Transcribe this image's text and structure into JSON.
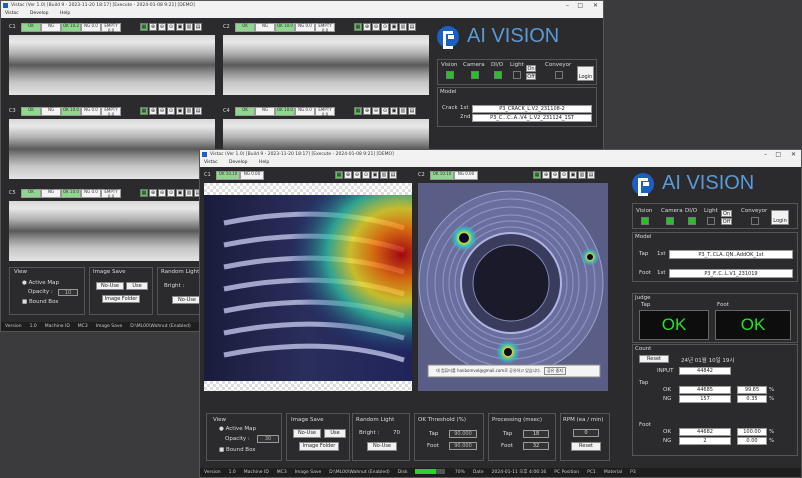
{
  "back": {
    "title": "Vistac (Ver 1.0) [Build 9 - 2023-11-20 18:17] [Execute - 2024-01-08 9:21] [DEMO]",
    "menu": [
      "Vistac",
      "Develop",
      "Help"
    ],
    "cameras": [
      {
        "label": "C1",
        "stats": [
          "OK",
          "NG",
          "OK 10.2",
          "NG 0.0",
          "EMPTY 0.0"
        ]
      },
      {
        "label": "C2",
        "stats": [
          "OK",
          "NG",
          "OK 10.0",
          "NG 0.0",
          "EMPTY 0.0"
        ]
      },
      {
        "label": "C3",
        "stats": [
          "OK",
          "NG",
          "OK 10.0",
          "NG 0.0",
          "EMPTY 0.0"
        ]
      },
      {
        "label": "C4",
        "stats": [
          "OK",
          "NG",
          "OK 10.0",
          "NG 0.0",
          "EMPTY 0.0"
        ]
      },
      {
        "label": "C5",
        "stats": [
          "OK",
          "NG",
          "OK 10.0",
          "NG 0.0",
          "EMPTY 0.0"
        ]
      }
    ],
    "brand": "AI VISION",
    "status_labels": [
      "Vision",
      "Camera",
      "DI/O",
      "Light",
      "Conveyor"
    ],
    "light_on": "On",
    "light_off": "Off",
    "login": "Login",
    "model_title": "Model",
    "crack": "Crack",
    "first": "1st",
    "second": "2nd",
    "model1": "P3_CRACK_L.V2_231108-2",
    "model2": "P3_C...C..A..V4_L.V2_231124_1ST",
    "view": "View",
    "active_map": "Active Map",
    "opacity": "Opacity :",
    "opacity_val": "10",
    "bound_box": "Bound Box",
    "image_save": "Image Save",
    "no_use": "No-Use",
    "use": "Use",
    "image_folder": "Image Folder",
    "random_light": "Random Light",
    "bright": "Bright :",
    "statusbar": [
      "Version",
      "1.0",
      "Machine ID",
      "MC3",
      "Image Save",
      "D:\\ML00\\Wahnut (Enabled)"
    ]
  },
  "front": {
    "title": "Vistac (Ver 1.0) [Build 9 - 2023-11-20 18:17] [Execute - 2024-01-08 9:21] [DEMO]",
    "menu": [
      "Vistac",
      "Develop",
      "Help"
    ],
    "cameras": [
      {
        "label": "C1",
        "stats": [
          "OK 10.10",
          "NG 0.00"
        ]
      },
      {
        "label": "C2",
        "stats": [
          "OK 10.10",
          "NG 0.00"
        ]
      }
    ],
    "brand": "AI VISION",
    "status_labels": [
      "Vision",
      "Camera",
      "DI/O",
      "Light",
      "Conveyor"
    ],
    "light_on": "On",
    "light_off": "Off",
    "login": "Login",
    "model_title": "Model",
    "tap": "Tap",
    "foot": "Foot",
    "first": "1st",
    "model_tap": "P3_T..CLA..QN..AddOK_1st",
    "model_foot": "P3_F..C..L.V1_231019",
    "judge_title": "Judge",
    "judge_tap": "OK",
    "judge_foot": "OK",
    "count_title": "Count",
    "reset": "Reset",
    "count_date": "24년 01월 10일 19시",
    "input_label": "INPUT",
    "input_val": "44842",
    "tap_ok": "44685",
    "tap_ok_pct": "99.65",
    "tap_ng": "157",
    "tap_ng_pct": "0.35",
    "foot_ok": "44682",
    "foot_ok_pct": "100.00",
    "foot_ng": "2",
    "foot_ng_pct": "0.00",
    "ok": "OK",
    "ng": "NG",
    "pct": "%",
    "view": "View",
    "active_map": "Active Map",
    "opacity": "Opacity :",
    "opacity_val": "30",
    "bound_box": "Bound Box",
    "image_save": "Image Save",
    "no_use": "No-Use",
    "use": "Use",
    "image_folder": "Image Folder",
    "random_light": "Random Light",
    "bright": "Bright :",
    "bright_val": "70",
    "ok_threshold": "OK Threshold (%)",
    "th_tap": "90.000",
    "th_foot": "90.000",
    "processing": "Processing (msec)",
    "proc_tap": "18",
    "proc_foot": "32",
    "rpm": "RPM (ea / min)",
    "rpm_val": "0",
    "rpm_reset": "Reset",
    "dialog_text": "대 컴퓨터를 hanbomvol@gmail.com로 공유하고 있습니다.",
    "dialog_btn": "공유 중지",
    "statusbar": [
      "Version",
      "1.0",
      "Machine ID",
      "MC3",
      "Image Save",
      "D:\\ML00\\Wahnut (Enabled)",
      "Disk",
      "70%",
      "Date",
      "2024-01-11 오후 4:06:16",
      "PC Position",
      "PC1",
      "Material",
      "P3"
    ]
  }
}
